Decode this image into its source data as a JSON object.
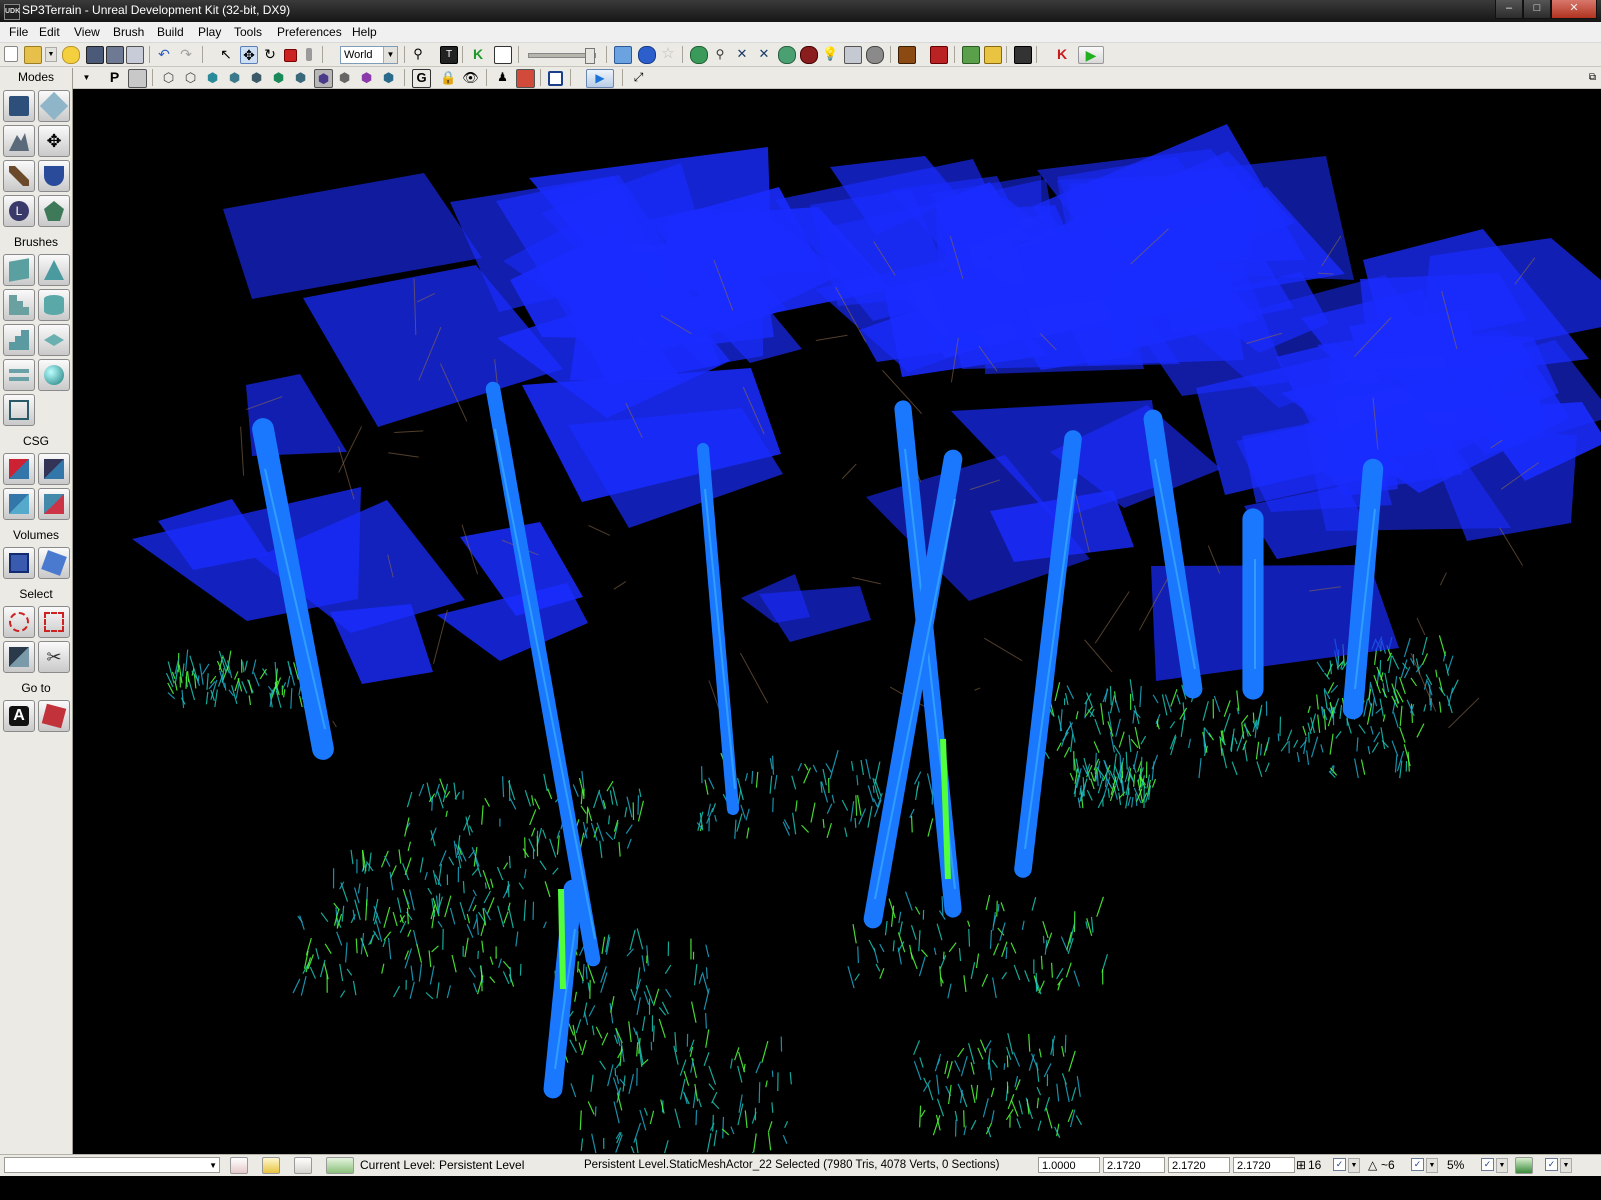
{
  "window": {
    "title": "SP3Terrain - Unreal Development Kit (32-bit, DX9)",
    "app_icon": "UDK",
    "buttons": {
      "minimize": "–",
      "maximize": "□",
      "close": "✕"
    }
  },
  "menu": [
    "File",
    "Edit",
    "View",
    "Brush",
    "Build",
    "Play",
    "Tools",
    "Preferences",
    "Help"
  ],
  "toolbar": {
    "coord_system": "World",
    "arrow": "▼"
  },
  "sidebar": {
    "modes_label": "Modes",
    "brushes_label": "Brushes",
    "csg_label": "CSG",
    "volumes_label": "Volumes",
    "select_label": "Select",
    "goto_label": "Go to",
    "goto_actor_letter": "A"
  },
  "viewport_toolbar": {
    "perspective_label": "P",
    "game_label": "G"
  },
  "status": {
    "current_level_label": "Current Level:",
    "current_level_value": "Persistent Level",
    "selection": "Persistent Level.StaticMeshActor_22 Selected (7980 Tris, 4078 Verts, 0 Sections)",
    "drag_grid": "1.0000",
    "scale_x": "2.1720",
    "scale_y": "2.1720",
    "scale_z": "2.1720",
    "grid_size": "16",
    "rot_snap": "~6",
    "scale_snap": "5%",
    "check": "✓",
    "arrow": "▼"
  },
  "colors": {
    "foliage_blue": "#1a2cff",
    "trunk_blue": "#1a78ff",
    "grass_cyan": "#19c6b4",
    "grass_green": "#52ff3c",
    "bg_toolbar": "#eceae4"
  }
}
